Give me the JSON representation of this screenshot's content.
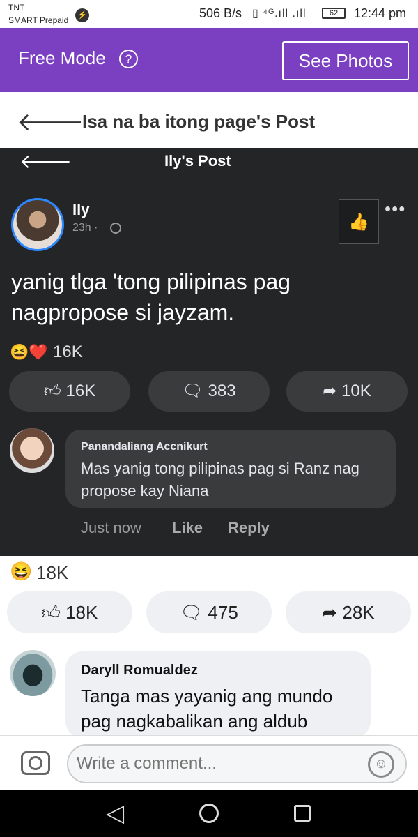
{
  "status_bar": {
    "carrier_line1": "TNT",
    "carrier_line2": "SMART Prepaid",
    "speed": "506 B/s",
    "battery": "62",
    "time": "12:44 pm",
    "signal_icons": "▯ ⁴ᴳ.ıll  .ıll"
  },
  "topbar": {
    "free_mode_label": "Free Mode",
    "help_glyph": "?",
    "see_photos_label": "See Photos"
  },
  "header": {
    "back_glyph": "🡐",
    "title": "Isa na ba itong page's Post"
  },
  "shared_screenshot": {
    "back_glyph": "🡐",
    "title": "Ily's Post",
    "author": "Ily",
    "time": "23h ·",
    "body": "yanig tlga 'tong pilipinas pag nagpropose si jayzam.",
    "reaction_count": "16K",
    "like_count": "16K",
    "comment_count": "383",
    "share_count": "10K",
    "comment": {
      "name": "Panandaliang Accnikurt",
      "text": "Mas yanig tong pilipinas pag si Ranz nag propose kay Niana",
      "time": "Just now",
      "like_label": "Like",
      "reply_label": "Reply"
    }
  },
  "post": {
    "reaction_count": "18K",
    "like_count": "18K",
    "comment_count": "475",
    "share_count": "28K"
  },
  "comment": {
    "name": "Daryll Romualdez",
    "text": "Tanga mas yayanig ang mundo pag nagkabalikan ang aldub"
  },
  "composer": {
    "placeholder": "Write a comment..."
  }
}
